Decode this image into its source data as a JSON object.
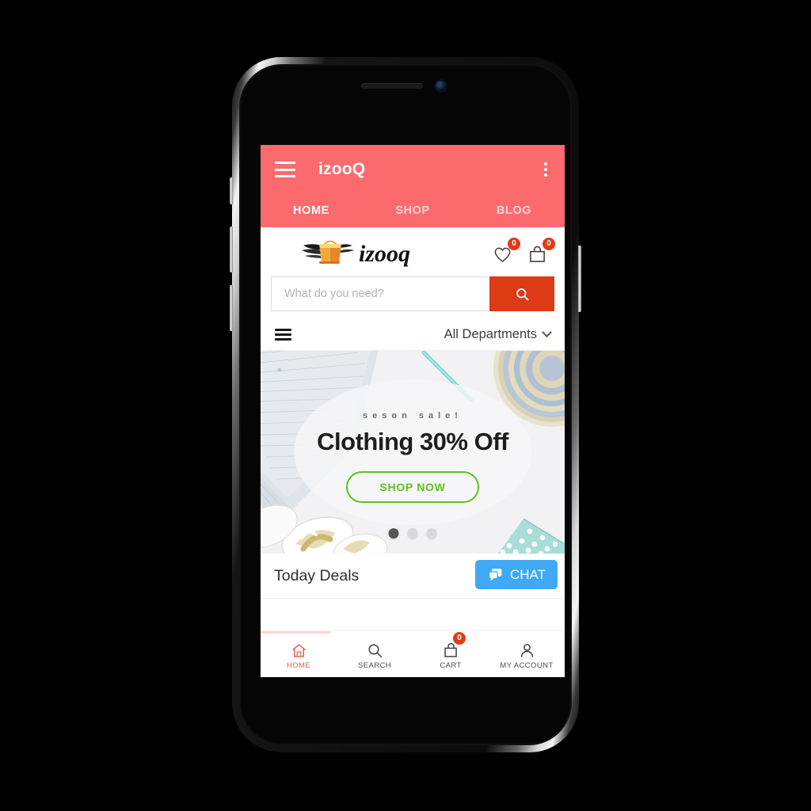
{
  "device": {
    "type": "smartphone-mockup"
  },
  "appbar": {
    "menu_icon": "hamburger-menu-icon",
    "title": "izooQ",
    "overflow_icon": "kebab-menu-icon",
    "tabs": [
      {
        "label": "HOME",
        "active": true
      },
      {
        "label": "SHOP",
        "active": false
      },
      {
        "label": "BLOG",
        "active": false
      }
    ],
    "background_color": "#fb6a6d"
  },
  "logo_row": {
    "logo_text": "izooq",
    "logo_icon": "winged-shopping-bag-icon",
    "wishlist": {
      "icon": "heart-icon",
      "count": "0"
    },
    "cart": {
      "icon": "shopping-bag-icon",
      "count": "0"
    },
    "badge_color": "#e23a18"
  },
  "search": {
    "placeholder": "What do you need?",
    "value": "",
    "button_icon": "search-icon",
    "button_color": "#dd3a16"
  },
  "departments": {
    "menu_icon": "hamburger-menu-icon",
    "label": "All Departments",
    "chevron_icon": "chevron-down-icon"
  },
  "hero": {
    "kicker": "seson sale!",
    "title": "Clothing 30% Off",
    "cta_label": "SHOP NOW",
    "cta_color": "#5fc21a",
    "dots": [
      {
        "active": true
      },
      {
        "active": false
      },
      {
        "active": false
      }
    ]
  },
  "deals": {
    "title": "Today Deals",
    "chat_label": "CHAT",
    "chat_icon": "chat-bubble-icon",
    "chat_color": "#3fa9f5"
  },
  "bottom_nav": {
    "items": [
      {
        "label": "HOME",
        "icon": "home-icon",
        "active": true,
        "badge": ""
      },
      {
        "label": "SEARCH",
        "icon": "search-icon",
        "active": false,
        "badge": ""
      },
      {
        "label": "CART",
        "icon": "shopping-bag-icon",
        "active": false,
        "badge": "0"
      },
      {
        "label": "MY ACCOUNT",
        "icon": "user-icon",
        "active": false,
        "badge": ""
      }
    ],
    "active_color": "#e8604f"
  }
}
